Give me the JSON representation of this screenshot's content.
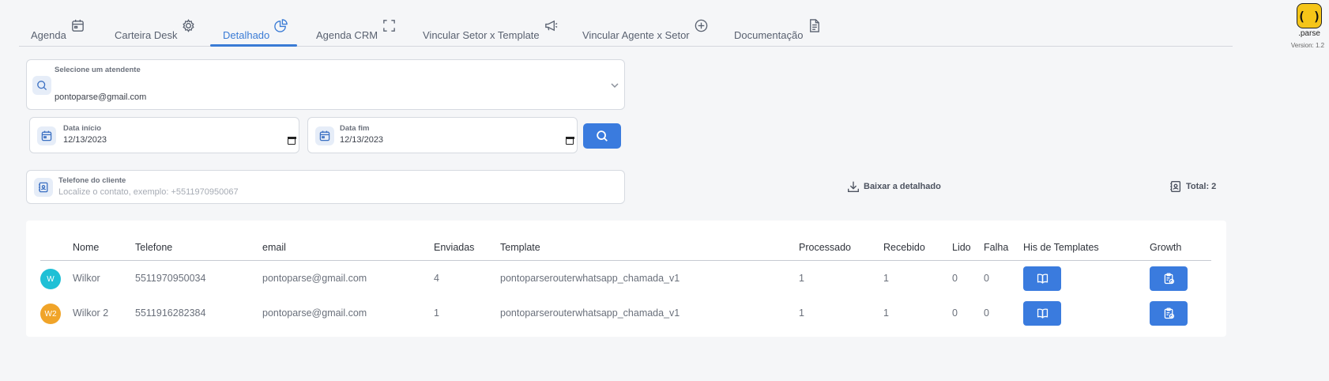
{
  "tabs": [
    {
      "label": "Agenda",
      "icon": "calendar-icon",
      "active": false
    },
    {
      "label": "Carteira Desk",
      "icon": "gear-icon",
      "active": false
    },
    {
      "label": "Detalhado",
      "icon": "pie-chart-icon",
      "active": true
    },
    {
      "label": "Agenda CRM",
      "icon": "expand-icon",
      "active": false
    },
    {
      "label": "Vincular Setor x Template",
      "icon": "megaphone-icon",
      "active": false
    },
    {
      "label": "Vincular Agente x Setor",
      "icon": "plus-circle-icon",
      "active": false
    },
    {
      "label": "Documentação",
      "icon": "document-icon",
      "active": false
    }
  ],
  "brand": {
    "name": ".parse",
    "version": "Version: 1.2",
    "color": "#f5c518"
  },
  "filters": {
    "atendente_label": "Selecione um atendente",
    "atendente_value": "pontoparse@gmail.com",
    "data_inicio_label": "Data início",
    "data_inicio_value": "12/13/2023",
    "data_fim_label": "Data fim",
    "data_fim_value": "12/13/2023",
    "telefone_label": "Telefone do cliente",
    "telefone_placeholder": "Localize o contato, exemplo: +5511970950067"
  },
  "actions": {
    "download_label": "Baixar a detalhado",
    "total_label": "Total: 2"
  },
  "table": {
    "headers": {
      "nome": "Nome",
      "telefone": "Telefone",
      "email": "email",
      "enviadas": "Enviadas",
      "template": "Template",
      "processado": "Processado",
      "recebido": "Recebido",
      "lido": "Lido",
      "falha": "Falha",
      "his": "His de Templates",
      "growth": "Growth"
    },
    "rows": [
      {
        "avatar": "W",
        "avatar_color": "#1fc0d6",
        "nome": "Wilkor",
        "telefone": "5511970950034",
        "email": "pontoparse@gmail.com",
        "enviadas": "4",
        "template": "pontoparserouterwhatsapp_chamada_v1",
        "processado": "1",
        "recebido": "1",
        "lido": "0",
        "falha": "0"
      },
      {
        "avatar": "W2",
        "avatar_color": "#f0a429",
        "nome": "Wilkor 2",
        "telefone": "5511916282384",
        "email": "pontoparse@gmail.com",
        "enviadas": "1",
        "template": "pontoparserouterwhatsapp_chamada_v1",
        "processado": "1",
        "recebido": "1",
        "lido": "0",
        "falha": "0"
      }
    ]
  },
  "colors": {
    "accent": "#3a7bde",
    "active_tab": "#3a7bd5"
  }
}
